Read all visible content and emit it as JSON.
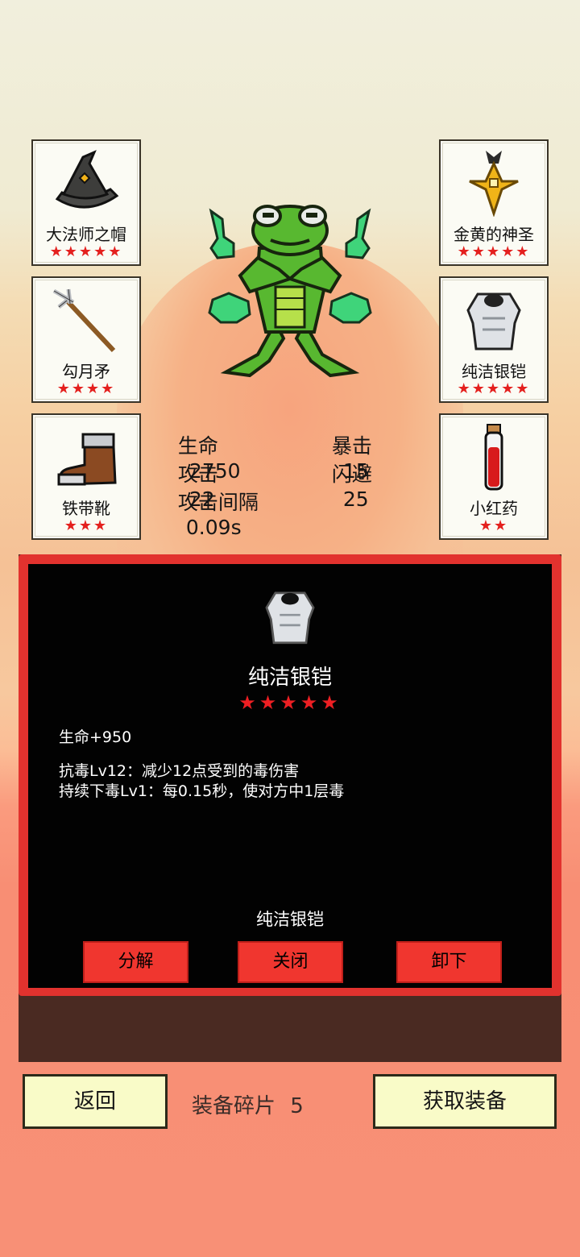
{
  "equipment_left": [
    {
      "name": "大法师之帽",
      "stars": "★★★★★",
      "icon": "wizard-hat-icon"
    },
    {
      "name": "勾月矛",
      "stars": "★★★★",
      "icon": "spear-icon"
    },
    {
      "name": "铁带靴",
      "stars": "★★★",
      "icon": "boot-icon"
    }
  ],
  "equipment_right": [
    {
      "name": "金黄的神圣",
      "stars": "★★★★★",
      "icon": "golden-amulet-icon"
    },
    {
      "name": "纯洁银铠",
      "stars": "★★★★★",
      "icon": "silver-armor-icon"
    },
    {
      "name": "小红药",
      "stars": "★★",
      "icon": "red-potion-icon"
    }
  ],
  "stats": {
    "hp_label": "生命",
    "hp_value": "2750",
    "crit_label": "暴击",
    "crit_value": "15",
    "atk_label": "攻击",
    "atk_value": "22",
    "dodge_label": "闪避",
    "dodge_value": "25",
    "interval_label": "攻击间隔",
    "interval_value": "0.09s"
  },
  "detail": {
    "icon": "silver-armor-icon",
    "title": "纯洁银铠",
    "stars": "★★★★★",
    "stat_line": "生命+950",
    "effect_1": "抗毒Lv12：减少12点受到的毒伤害",
    "effect_2": "持续下毒Lv1：每0.15秒，使对方中1层毒",
    "footer_name": "纯洁银铠",
    "btn_decompose": "分解",
    "btn_close": "关闭",
    "btn_unequip": "卸下"
  },
  "bottom": {
    "back_label": "返回",
    "shards_label": "装备碎片",
    "shards_count": "5",
    "get_equipment_label": "获取装备"
  },
  "colors": {
    "star": "#e4201e",
    "button_red": "#f0362f",
    "button_cream": "#f9fbc8",
    "frog_green": "#58b830",
    "spirit_green": "#3fd47a"
  }
}
